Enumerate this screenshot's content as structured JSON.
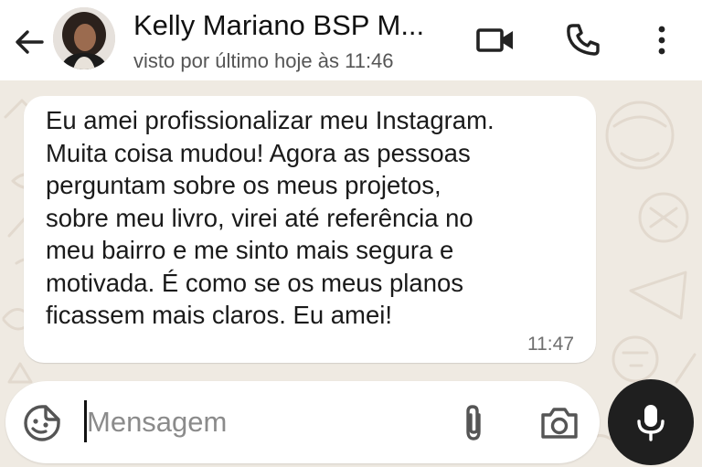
{
  "header": {
    "contact_name": "Kelly Mariano BSP M...",
    "status": "visto por último hoje às 11:46",
    "icons": {
      "back": "arrow-back-icon",
      "video": "video-call-icon",
      "call": "phone-call-icon",
      "menu": "more-vert-icon"
    }
  },
  "message": {
    "text": "Eu amei profissionalizar meu Instagram.\nMuita coisa mudou! Agora as pessoas\nperguntam sobre os meus projetos,\nsobre meu livro, virei até referência  no\nmeu bairro e me sinto mais segura e\nmotivada. É como se os meus planos\nficassem mais claros. Eu amei!",
    "time": "11:47"
  },
  "composer": {
    "placeholder": "Mensagem",
    "icons": {
      "emoji": "sticker-emoji-icon",
      "attach": "paperclip-icon",
      "camera": "camera-icon",
      "mic": "microphone-icon"
    }
  },
  "colors": {
    "header_bg": "#ffffff",
    "chat_bg": "#efeae2",
    "bubble_bg": "#ffffff",
    "mic_button": "#1f1f1f"
  }
}
